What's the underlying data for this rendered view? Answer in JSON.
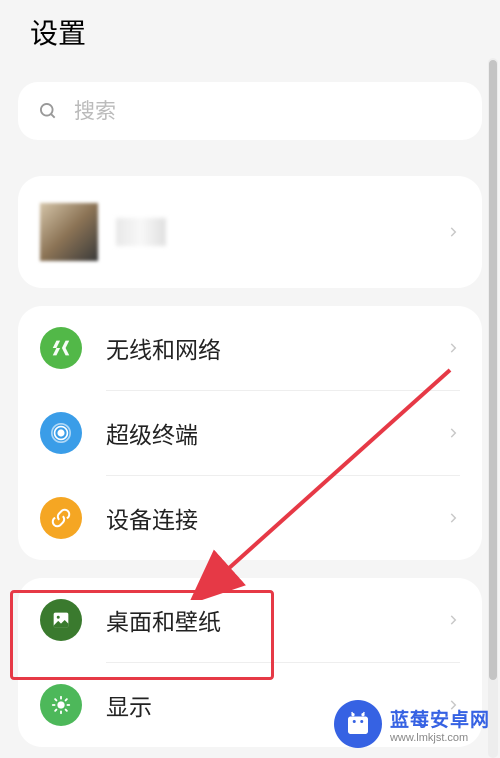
{
  "page": {
    "title": "设置"
  },
  "search": {
    "placeholder": "搜索"
  },
  "items": {
    "wireless": {
      "label": "无线和网络"
    },
    "super_device": {
      "label": "超级终端"
    },
    "device_connect": {
      "label": "设备连接"
    },
    "home_wallpaper": {
      "label": "桌面和壁纸"
    },
    "display": {
      "label": "显示"
    }
  },
  "watermark": {
    "title": "蓝莓安卓网",
    "url": "www.lmkjst.com"
  }
}
